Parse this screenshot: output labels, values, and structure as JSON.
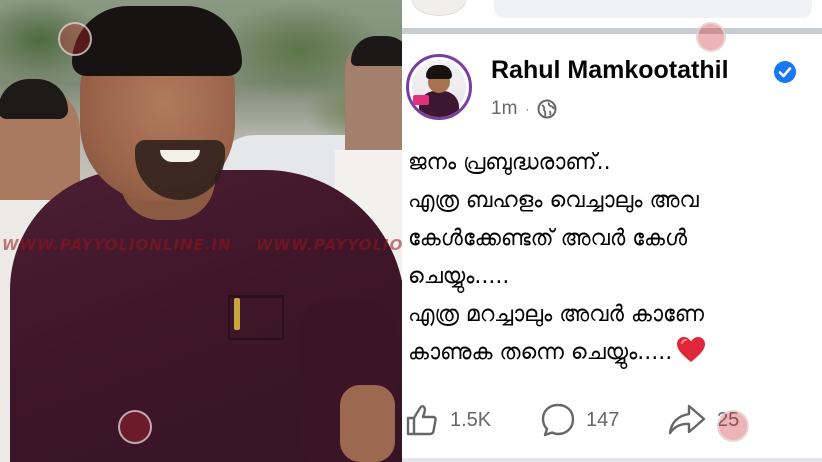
{
  "photo": {
    "description_icon": "person-photo",
    "watermark_text": "WWW.PAYYOLIONLINE.IN",
    "watermark_text_2": "WWW.PAYYOLIONLINE.IN",
    "watermark_logo_icon": "payyoli-logo-icon"
  },
  "post": {
    "author": "Rahul Mamkootathil",
    "verified_icon": "verified-badge-icon",
    "time": "1m",
    "separator": "·",
    "privacy_icon": "globe-icon",
    "text_lines": [
      "ജനം പ്രബുദ്ധരാണ്..",
      "എത്ര ബഹളം വെച്ചാലും അവ",
      "കേൾക്കേണ്ടത് അവർ കേൾ",
      "ചെയ്യും.....",
      "എത്ര മറച്ചാലും അവർ കാണേ",
      "കാണുക തന്നെ ചെയ്യും....."
    ],
    "emoji": "heart-icon",
    "actions": {
      "like_count": "1.5K",
      "comment_count": "147",
      "share_count": "25"
    }
  },
  "colors": {
    "facebook_blue": "#1877f2",
    "text_primary": "#050505",
    "text_secondary": "#65676b",
    "heart_red": "#e0263b"
  }
}
